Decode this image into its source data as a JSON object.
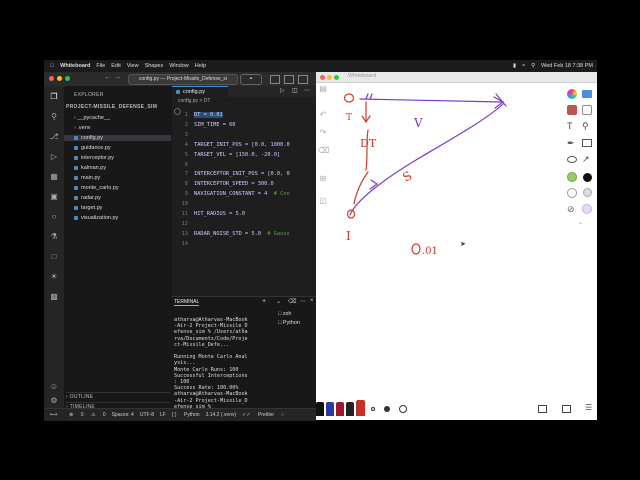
{
  "menubar": {
    "app": "Whiteboard",
    "items": [
      "File",
      "Edit",
      "View",
      "Shapes",
      "Window",
      "Help"
    ],
    "datetime": "Wed Feb 18  7:38 PM"
  },
  "vscode": {
    "command_center": "config.py — Project-Missile_Defense_si",
    "explorer_title": "EXPLORER",
    "project_title": "PROJECT-MISSILE_DEFENSE_SIM",
    "files": [
      "__pycache__",
      ".venv",
      "config.py",
      "guidance.py",
      "interceptor.py",
      "kalman.py",
      "main.py",
      "monte_carlo.py",
      "radar.py",
      "target.py",
      "visualization.py"
    ],
    "outline": "OUTLINE",
    "timeline": "TIMELINE",
    "tab_label": "config.py",
    "breadcrumb": "config.py > DT",
    "code_lines": [
      {
        "n": "1",
        "text": "DT = 0.01",
        "comment": ""
      },
      {
        "n": "2",
        "text": "SIM_TIME = 60",
        "comment": ""
      },
      {
        "n": "3",
        "text": "",
        "comment": ""
      },
      {
        "n": "4",
        "text": "TARGET_INIT_POS = [0.0, 1000.0",
        "comment": ""
      },
      {
        "n": "5",
        "text": "TARGET_VEL = [150.0, -20.0]",
        "comment": ""
      },
      {
        "n": "6",
        "text": "",
        "comment": ""
      },
      {
        "n": "7",
        "text": "INTERCEPTOR_INIT_POS = [0.0, 0",
        "comment": ""
      },
      {
        "n": "8",
        "text": "INTERCEPTOR_SPEED = 300.0",
        "comment": ""
      },
      {
        "n": "9",
        "text": "NAVIGATION_CONSTANT = 4  ",
        "comment": "# Con"
      },
      {
        "n": "10",
        "text": "",
        "comment": ""
      },
      {
        "n": "11",
        "text": "HIT_RADIUS = 5.0",
        "comment": ""
      },
      {
        "n": "12",
        "text": "",
        "comment": ""
      },
      {
        "n": "13",
        "text": "RADAR_NOISE_STD = 5.0  ",
        "comment": "# Gauss"
      },
      {
        "n": "14",
        "text": "",
        "comment": ""
      }
    ],
    "terminal_tab": "TERMINAL",
    "terminal_output": "atharva@Atharvas-MacBook\n-Air-2 Project-Missile_D\nefense_sim % /Users/atha\nrva/Documents/Code/Proje\nct-Missile_Defe...\n\nRunning Monte Carlo Anal\nysis...\nMonte Carlo Runs: 100\nSuccessful Interceptions\n: 100\nSuccess Rate: 100.00%\natharva@Atharvas-MacBook\n-Air-2 Project-Missile_D\nefense_sim %",
    "terminal_list": [
      "zsh",
      "Python"
    ],
    "status": {
      "errors": "0",
      "warnings": "0",
      "spaces": "Spaces: 4",
      "encoding": "UTF-8",
      "eol": "LF",
      "language": "Python",
      "interpreter": "3.14.2 (.venv)",
      "formatter": "Prettier"
    }
  },
  "whiteboard": {
    "title": "Whiteboard",
    "labels": {
      "o_top": "O",
      "t_top": "T",
      "v": "V",
      "dt": "DT",
      "s": "S",
      "o_bottom": "O",
      "i": "I",
      "value": "0.01"
    },
    "ink_colors": {
      "red": "#d23a2f",
      "purple": "#7a3cc8"
    }
  }
}
